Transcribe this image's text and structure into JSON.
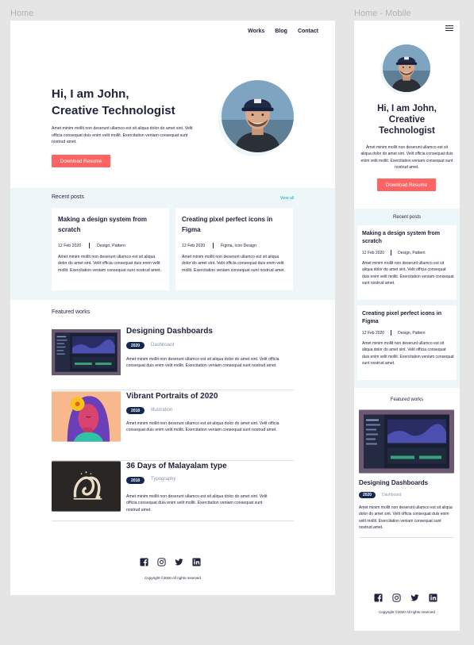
{
  "frames": {
    "desktop_label": "Home",
    "mobile_label": "Home - Mobile"
  },
  "nav": {
    "items": [
      "Works",
      "Blog",
      "Contact"
    ]
  },
  "hero": {
    "title_line1": "Hi, I am John,",
    "title_line2": "Creative Technologist",
    "mobile_title_line1": "Hi, I am John,",
    "mobile_title_line2": "Creative",
    "mobile_title_line3": "Technologist",
    "description": "Amet minim mollit non deserunt ullamco est sit aliqua dolor do amet sint. Velit officia consequat duis enim velit mollit. Exercitation veniam consequat sunt nostrud amet.",
    "button_label": "Download Resume"
  },
  "recent": {
    "title": "Recent posts",
    "view_all": "View all",
    "posts": [
      {
        "title": "Making a design system from scratch",
        "date": "12 Feb 2020",
        "tags": "Design, Pattern",
        "excerpt": "Amet minim mollit non deserunt ullamco est sit aliqua dolor do amet sint. Velit officia consequat duis enim velit mollit. Exercitation veniam consequat sunt nostrud amet."
      },
      {
        "title": "Creating pixel perfect icons in Figma",
        "date": "12 Feb 2020",
        "tags": "Figma, Icon Design",
        "mobile_tags": "Design, Pattern",
        "excerpt": "Amet minim mollit non deserunt ullamco est sit aliqua dolor do amet sint. Velit officia consequat duis enim velit mollit. Exercitation veniam consequat sunt nostrud amet."
      }
    ]
  },
  "featured": {
    "title": "Featured works",
    "works": [
      {
        "title": "Designing Dashboards",
        "year": "2020",
        "category": "Dashboard",
        "description": "Amet minim mollit non deserunt ullamco est sit aliqua dolor do amet sint. Velit officia consequat duis enim velit mollit. Exercitation veniam consequat sunt nostrud amet."
      },
      {
        "title": "Vibrant Portraits of 2020",
        "year": "2018",
        "category": "Illustration",
        "description": "Amet minim mollit non deserunt ullamco est sit aliqua dolor do amet sint. Velit officia consequat duis enim velit mollit. Exercitation veniam consequat sunt nostrud amet."
      },
      {
        "title": "36 Days of Malayalam type",
        "year": "2018",
        "category": "Typography",
        "description": "Amet minim mollit non deserunt ullamco est sit aliqua dolor do amet sint. Velit officia consequat duis enim velit mollit. Exercitation veniam consequat sunt nostrud amet."
      }
    ]
  },
  "footer": {
    "icons": [
      "facebook-icon",
      "instagram-icon",
      "twitter-icon",
      "linkedin-icon"
    ],
    "copyright": "Copyright ©2020 All rights reserved"
  },
  "colors": {
    "accent": "#ff6464",
    "badge": "#142850",
    "text": "#21243d",
    "muted": "#8695a4",
    "section_bg": "#edf7fa",
    "link": "#00a8cc"
  }
}
